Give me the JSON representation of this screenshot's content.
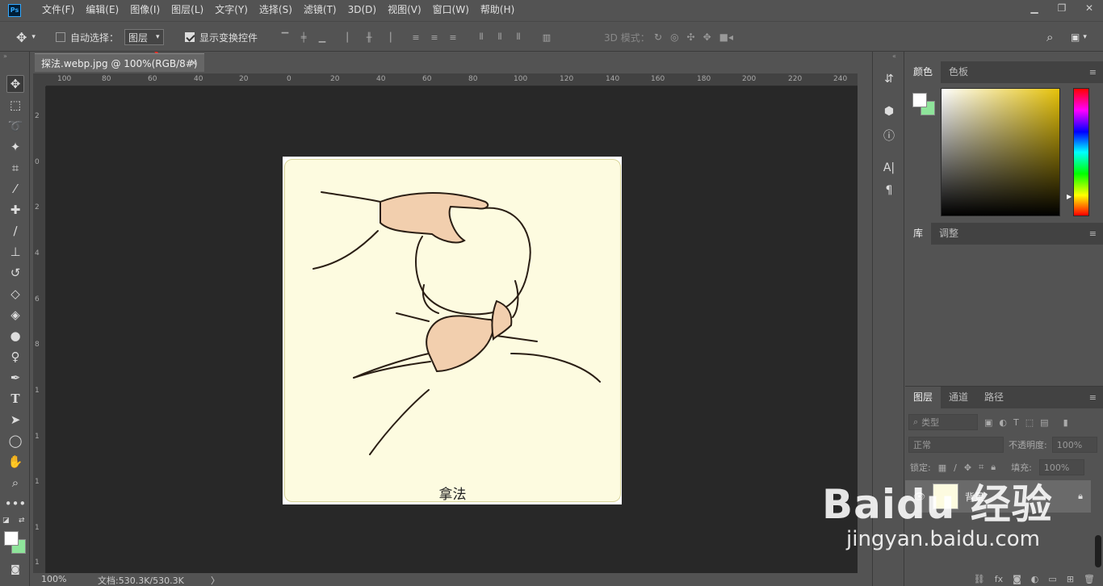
{
  "app": {
    "logo": "Ps"
  },
  "menu": [
    "文件(F)",
    "编辑(E)",
    "图像(I)",
    "图层(L)",
    "文字(Y)",
    "选择(S)",
    "滤镜(T)",
    "3D(D)",
    "视图(V)",
    "窗口(W)",
    "帮助(H)"
  ],
  "window_controls": {
    "minimize": "▁",
    "restore": "❐",
    "close": "✕"
  },
  "options": {
    "auto_select_label": "自动选择：",
    "auto_select_value": "图层",
    "show_transform_label": "显示变换控件",
    "mode_3d_label": "3D 模式："
  },
  "document": {
    "tab_title": "探法.webp.jpg @ 100%(RGB/8#)",
    "close": "✕"
  },
  "ruler_h": [
    "100",
    "80",
    "60",
    "40",
    "20",
    "0",
    "20",
    "40",
    "60",
    "80",
    "100",
    "120",
    "140",
    "160",
    "180",
    "200",
    "220",
    "240"
  ],
  "ruler_v": [
    "2",
    "0",
    "2",
    "4",
    "6",
    "8",
    "1",
    "1",
    "1",
    "1",
    "1"
  ],
  "artwork": {
    "caption": "拿法"
  },
  "status": {
    "zoom": "100%",
    "doc_info": "文档:530.3K/530.3K",
    "arrow": "〉"
  },
  "panels": {
    "color_tabs": [
      "颜色",
      "色板"
    ],
    "library_tabs": [
      "库",
      "调整"
    ],
    "layers_tabs": [
      "图层",
      "通道",
      "路径"
    ],
    "layer_filter": "类型",
    "blend_mode": "正常",
    "opacity_label": "不透明度:",
    "opacity_value": "100%",
    "lock_label": "锁定:",
    "fill_label": "填充:",
    "fill_value": "100%",
    "layer_name": "背景"
  },
  "colors": {
    "foreground": "#ffffff",
    "background": "#8ee49a"
  },
  "watermark": {
    "logo": "Baidu 经验",
    "url": "jingyan.baidu.com"
  }
}
